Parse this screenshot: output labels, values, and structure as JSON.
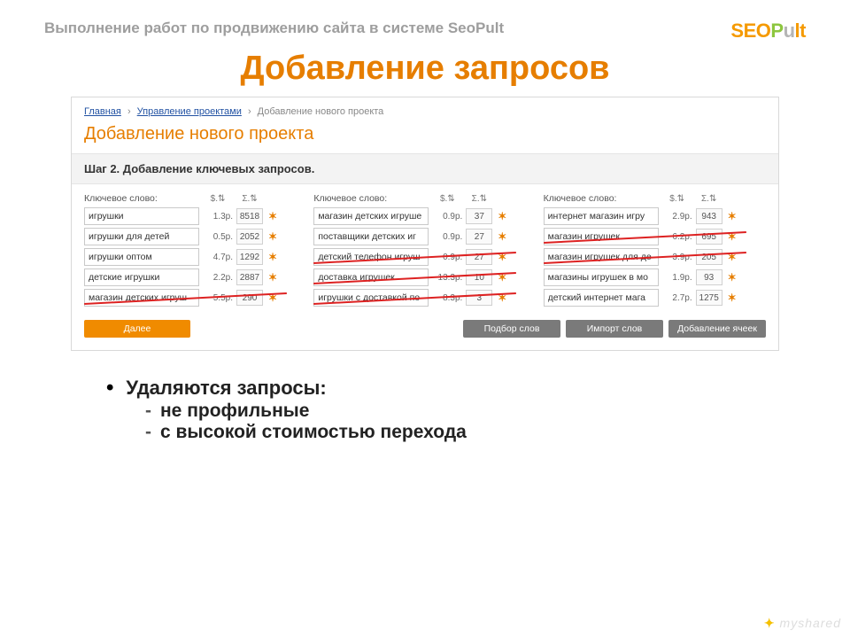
{
  "header": {
    "subtitle": "Выполнение работ по продвижению сайта в системе SeoPult",
    "logo": {
      "seo": "SE",
      "o": "O",
      "p": "P",
      "u": "u",
      "lt": "lt"
    }
  },
  "title": "Добавление запросов",
  "screenshot": {
    "breadcrumb": {
      "home": "Главная",
      "projects": "Управление проектами",
      "current": "Добавление нового проекта"
    },
    "project_title": "Добавление нового проекта",
    "step_title": "Шаг 2. Добавление ключевых запросов.",
    "col_label": "Ключевое слово:",
    "metric1": "$.⇅",
    "metric2": "Σ.⇅",
    "columns": [
      {
        "rows": [
          {
            "kw": "игрушки",
            "price": "1.3р.",
            "count": "8518",
            "strike": false
          },
          {
            "kw": "игрушки для детей",
            "price": "0.5р.",
            "count": "2052",
            "strike": false
          },
          {
            "kw": "игрушки оптом",
            "price": "4.7р.",
            "count": "1292",
            "strike": false
          },
          {
            "kw": "детские игрушки",
            "price": "2.2р.",
            "count": "2887",
            "strike": false
          },
          {
            "kw": "магазин детских игруш",
            "price": "5.5р.",
            "count": "290",
            "strike": true
          }
        ]
      },
      {
        "rows": [
          {
            "kw": "магазин детских игруше",
            "price": "0.9р.",
            "count": "37",
            "strike": false
          },
          {
            "kw": "поставщики детских иг",
            "price": "0.9р.",
            "count": "27",
            "strike": false
          },
          {
            "kw": "детский телефон игруш",
            "price": "0.9р.",
            "count": "27",
            "strike": true
          },
          {
            "kw": "доставка игрушек",
            "price": "13.3р.",
            "count": "10",
            "strike": true
          },
          {
            "kw": "игрушки с доставкой по",
            "price": "8.3р.",
            "count": "3",
            "strike": true
          }
        ]
      },
      {
        "rows": [
          {
            "kw": "интернет магазин игру",
            "price": "2.9р.",
            "count": "943",
            "strike": false
          },
          {
            "kw": "магазин игрушек",
            "price": "6.2р.",
            "count": "695",
            "strike": true
          },
          {
            "kw": "магазин игрушек для де",
            "price": "3.9р.",
            "count": "205",
            "strike": true
          },
          {
            "kw": "магазины игрушек в мо",
            "price": "1.9р.",
            "count": "93",
            "strike": false
          },
          {
            "kw": "детский интернет мага",
            "price": "2.7р.",
            "count": "1275",
            "strike": false
          }
        ]
      }
    ],
    "buttons": {
      "next": "Далее",
      "pick": "Подбор слов",
      "import": "Импорт слов",
      "add": "Добавление ячеек"
    }
  },
  "bullets": {
    "heading": "Удаляются запросы:",
    "items": [
      "не профильные",
      "с высокой стоимостью перехода"
    ]
  },
  "watermark": "myshared"
}
